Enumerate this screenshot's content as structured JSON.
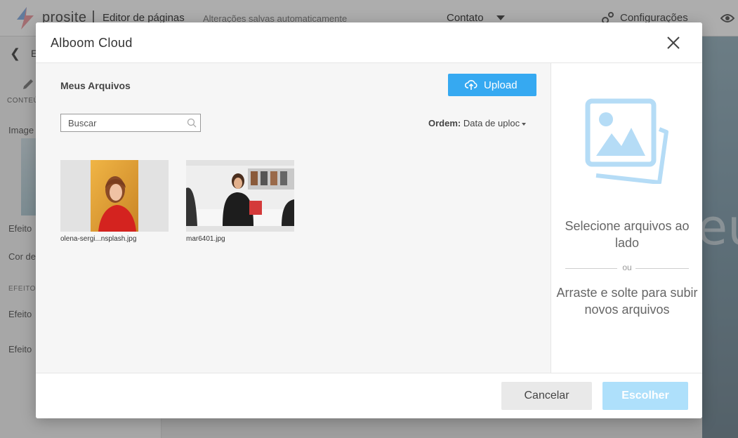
{
  "editor": {
    "brand": "prosite",
    "title": "Editor de páginas",
    "autosave": "Alterações salvas automaticamente",
    "page": "Contato",
    "settings": "Configurações",
    "left_panel": {
      "back_label": "E",
      "conteudo": "CONTEÚ",
      "imagem": "Image",
      "efeito1": "Efeito",
      "cor": "Cor de",
      "efeitos": "EFEITOS",
      "efeito2": "Efeito",
      "efeito3": "Efeito"
    },
    "preview_letter": "eú"
  },
  "modal": {
    "title": "Alboom Cloud",
    "files": {
      "heading": "Meus Arquivos",
      "upload_label": "Upload",
      "search_placeholder": "Buscar",
      "order_label": "Ordem:",
      "order_value": "Data de uploc",
      "items": [
        {
          "name": "olena-sergi...nsplash.jpg",
          "icon": "portrait-photo"
        },
        {
          "name": "mar6401.jpg",
          "icon": "store-photo"
        }
      ]
    },
    "dropzone": {
      "select_text": "Selecione arquivos ao lado",
      "or_text": "ou",
      "drag_text": "Arraste e solte para subir novos arquivos"
    },
    "footer": {
      "cancel_label": "Cancelar",
      "choose_label": "Escolher"
    }
  },
  "colors": {
    "accent": "#36a9f1",
    "accent_disabled": "#aee0fb",
    "illustration": "#b5dcf6"
  }
}
